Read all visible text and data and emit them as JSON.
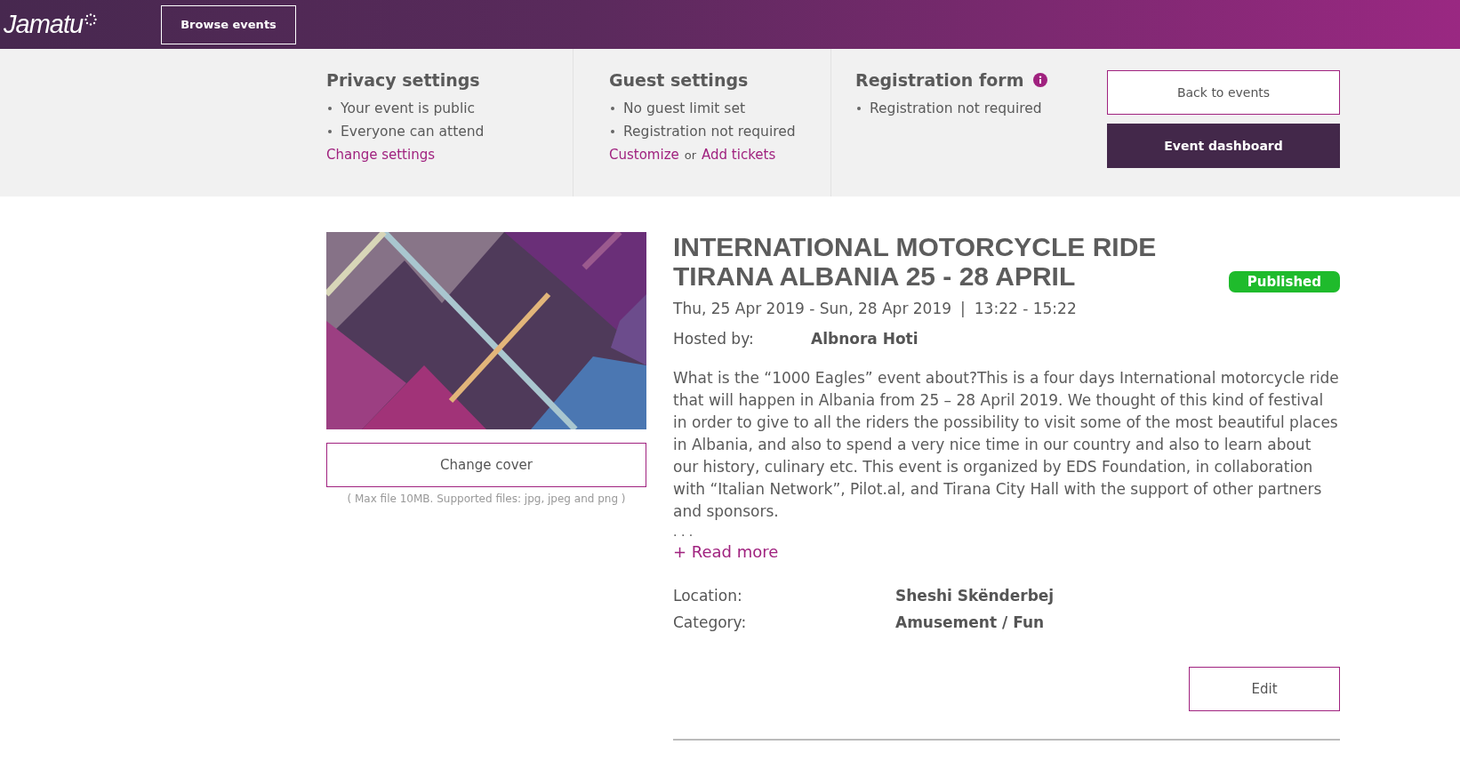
{
  "header": {
    "logo": "Jamatu",
    "browse_button": "Browse events"
  },
  "settings": [
    {
      "title": "Privacy settings",
      "info": false,
      "items": [
        "Your event is public",
        "Everyone can attend"
      ],
      "links": [
        {
          "kind": "link",
          "text": "Change settings"
        }
      ]
    },
    {
      "title": "Guest settings",
      "info": false,
      "items": [
        "No guest limit set",
        "Registration not required"
      ],
      "links": [
        {
          "kind": "link",
          "text": "Customize"
        },
        {
          "kind": "plain",
          "text": "or"
        },
        {
          "kind": "link",
          "text": "Add tickets"
        }
      ]
    },
    {
      "title": "Registration form",
      "info": true,
      "items": [
        "Registration not required"
      ]
    }
  ],
  "actions": {
    "back": "Back to events",
    "dashboard": "Event dashboard"
  },
  "cover": {
    "button": "Change cover",
    "hint": "( Max file 10MB. Supported files: jpg, jpeg and png )"
  },
  "event": {
    "title": "INTERNATIONAL MOTORCYCLE RIDE TIRANA ALBANIA 25 - 28 APRIL",
    "status": "Published",
    "dates": "Thu, 25 Apr 2019 - Sun, 28 Apr 2019",
    "separator": "|",
    "times": "13:22 - 15:22",
    "host_label": "Hosted by:",
    "host": "Albnora Hoti",
    "description": "What is the “1000 Eagles” event about?This is a four days International motorcycle ride that will happen in Albania from 25 – 28 April 2019. We thought of this kind of festival in order to give to all the riders the possibility to visit some of the most beautiful places in Albania, and also to spend a very nice time in our country and also to learn about our history, culinary etc. This event is organized by EDS Foundation, in collaboration with “Italian Network”, Pilot.al, and Tirana City Hall with the support of other partners and sponsors.",
    "ellipsis": ". . .",
    "read_more": "+ Read more",
    "details": [
      {
        "label": "Location:",
        "value": "Sheshi Skënderbej"
      },
      {
        "label": "Category:",
        "value": "Amusement / Fun"
      }
    ],
    "edit_button": "Edit"
  }
}
